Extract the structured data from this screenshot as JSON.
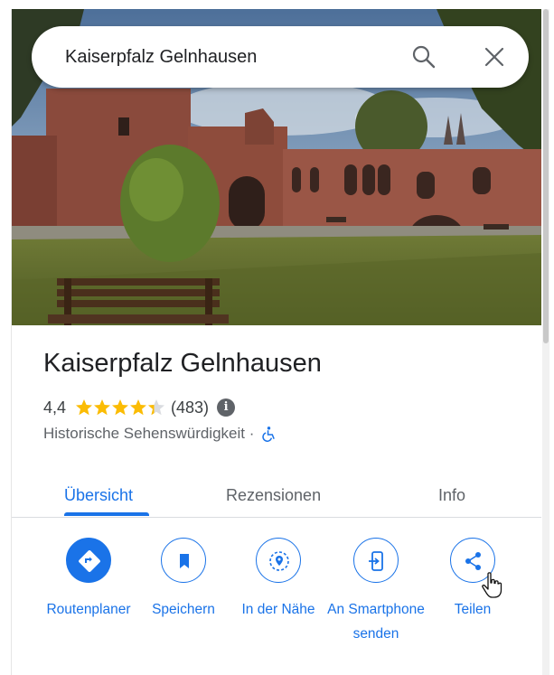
{
  "search": {
    "query": "Kaiserpfalz Gelnhausen"
  },
  "place": {
    "title": "Kaiserpfalz Gelnhausen",
    "rating": "4,4",
    "rating_value": 4.4,
    "review_count": "(483)",
    "info_icon": "i",
    "category": "Historische Sehenswürdigkeit · "
  },
  "tabs": [
    {
      "label": "Übersicht",
      "active": true
    },
    {
      "label": "Rezensionen",
      "active": false
    },
    {
      "label": "Info",
      "active": false
    }
  ],
  "actions": [
    {
      "label": "Routenplaner",
      "icon": "directions-icon"
    },
    {
      "label": "Speichern",
      "icon": "bookmark-icon"
    },
    {
      "label": "In der Nähe",
      "icon": "nearby-icon"
    },
    {
      "label": "An Smartphone senden",
      "icon": "send-to-phone-icon"
    },
    {
      "label": "Teilen",
      "icon": "share-icon"
    }
  ],
  "colors": {
    "accent": "#1a73e8",
    "star": "#fbbc04",
    "text": "#202124",
    "secondary": "#5f6368"
  }
}
